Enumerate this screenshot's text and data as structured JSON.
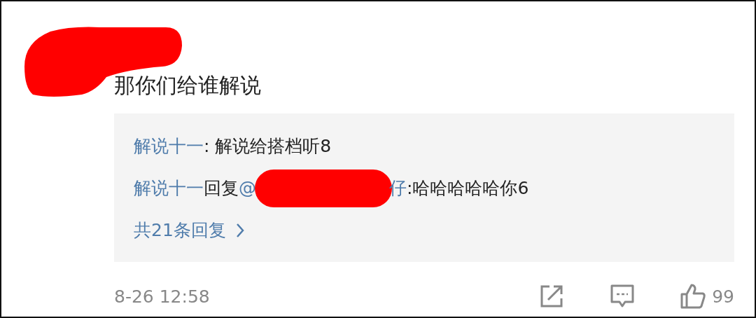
{
  "comment": {
    "text": "那你们给谁解说",
    "replies": [
      {
        "kind": "plain",
        "author": "解说十一",
        "text": ": 解说给搭档听8"
      },
      {
        "kind": "reply",
        "author": "解说十一",
        "verb": "回复",
        "mention_start": "@",
        "mention_end": "仔",
        "text": ":哈哈哈哈哈你6"
      }
    ],
    "more_replies": "共21条回复",
    "time": "8-26 12:58",
    "like_count": "99"
  }
}
